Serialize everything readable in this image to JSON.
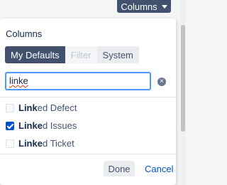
{
  "header": {
    "columns_button_label": "Columns"
  },
  "panel": {
    "title": "Columns",
    "tabs": [
      {
        "label": "My Defaults",
        "state": "active"
      },
      {
        "label": "Filter",
        "state": "disabled"
      },
      {
        "label": "System",
        "state": "normal"
      }
    ],
    "search": {
      "value": "linke"
    },
    "options": [
      {
        "match": "Link",
        "rest": "ed Defect",
        "checked": false
      },
      {
        "match": "Linke",
        "rest": "d Issues",
        "checked": true
      },
      {
        "match": "Linke",
        "rest": "d Ticket",
        "checked": false
      }
    ],
    "done_label": "Done",
    "cancel_label": "Cancel"
  },
  "colors": {
    "accent": "#0052cc",
    "header_bg": "#42526e",
    "focus": "#4c9aff"
  }
}
